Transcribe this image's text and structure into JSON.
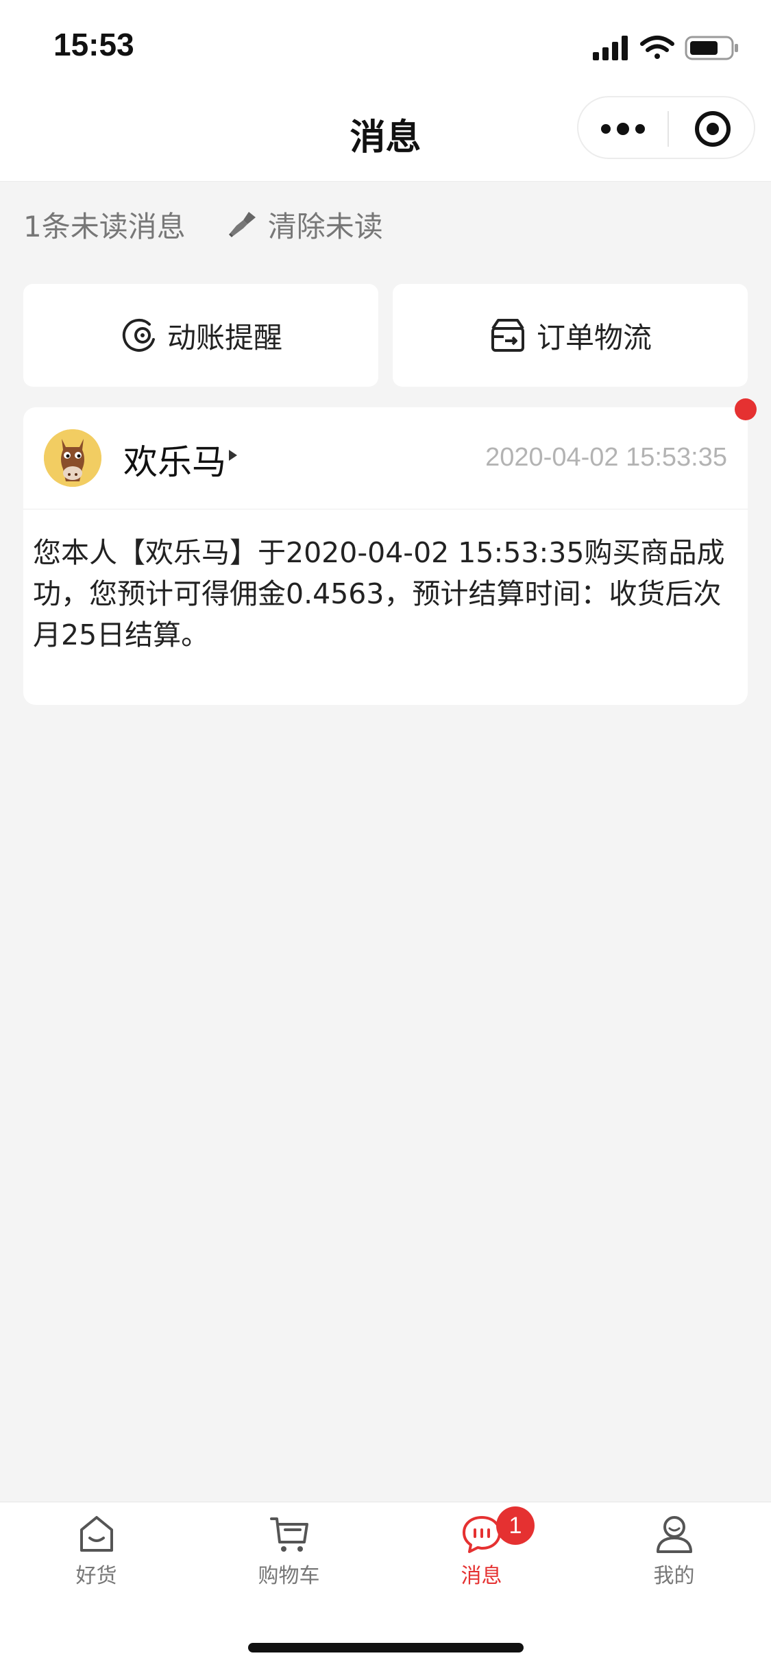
{
  "status_bar": {
    "time": "15:53"
  },
  "nav": {
    "title": "消息"
  },
  "unread": {
    "count_text": "1条未读消息",
    "clear_label": "清除未读"
  },
  "categories": [
    {
      "label": "动账提醒",
      "icon": "coin-alert-icon"
    },
    {
      "label": "订单物流",
      "icon": "delivery-box-icon"
    }
  ],
  "message": {
    "sender": "欢乐马",
    "time": "2020-04-02 15:53:35",
    "body": "您本人【欢乐马】于2020-04-02 15:53:35购买商品成功，您预计可得佣金0.4563，预计结算时间：收货后次月25日结算。",
    "unread": true
  },
  "tabs": [
    {
      "label": "好货",
      "icon": "home-icon",
      "active": false
    },
    {
      "label": "购物车",
      "icon": "cart-icon",
      "active": false
    },
    {
      "label": "消息",
      "icon": "chat-icon",
      "active": true,
      "badge": "1"
    },
    {
      "label": "我的",
      "icon": "user-icon",
      "active": false
    }
  ],
  "colors": {
    "accent": "#e53131",
    "background": "#f4f4f4",
    "muted_text": "#777777",
    "time_text": "#b3b3b3"
  }
}
